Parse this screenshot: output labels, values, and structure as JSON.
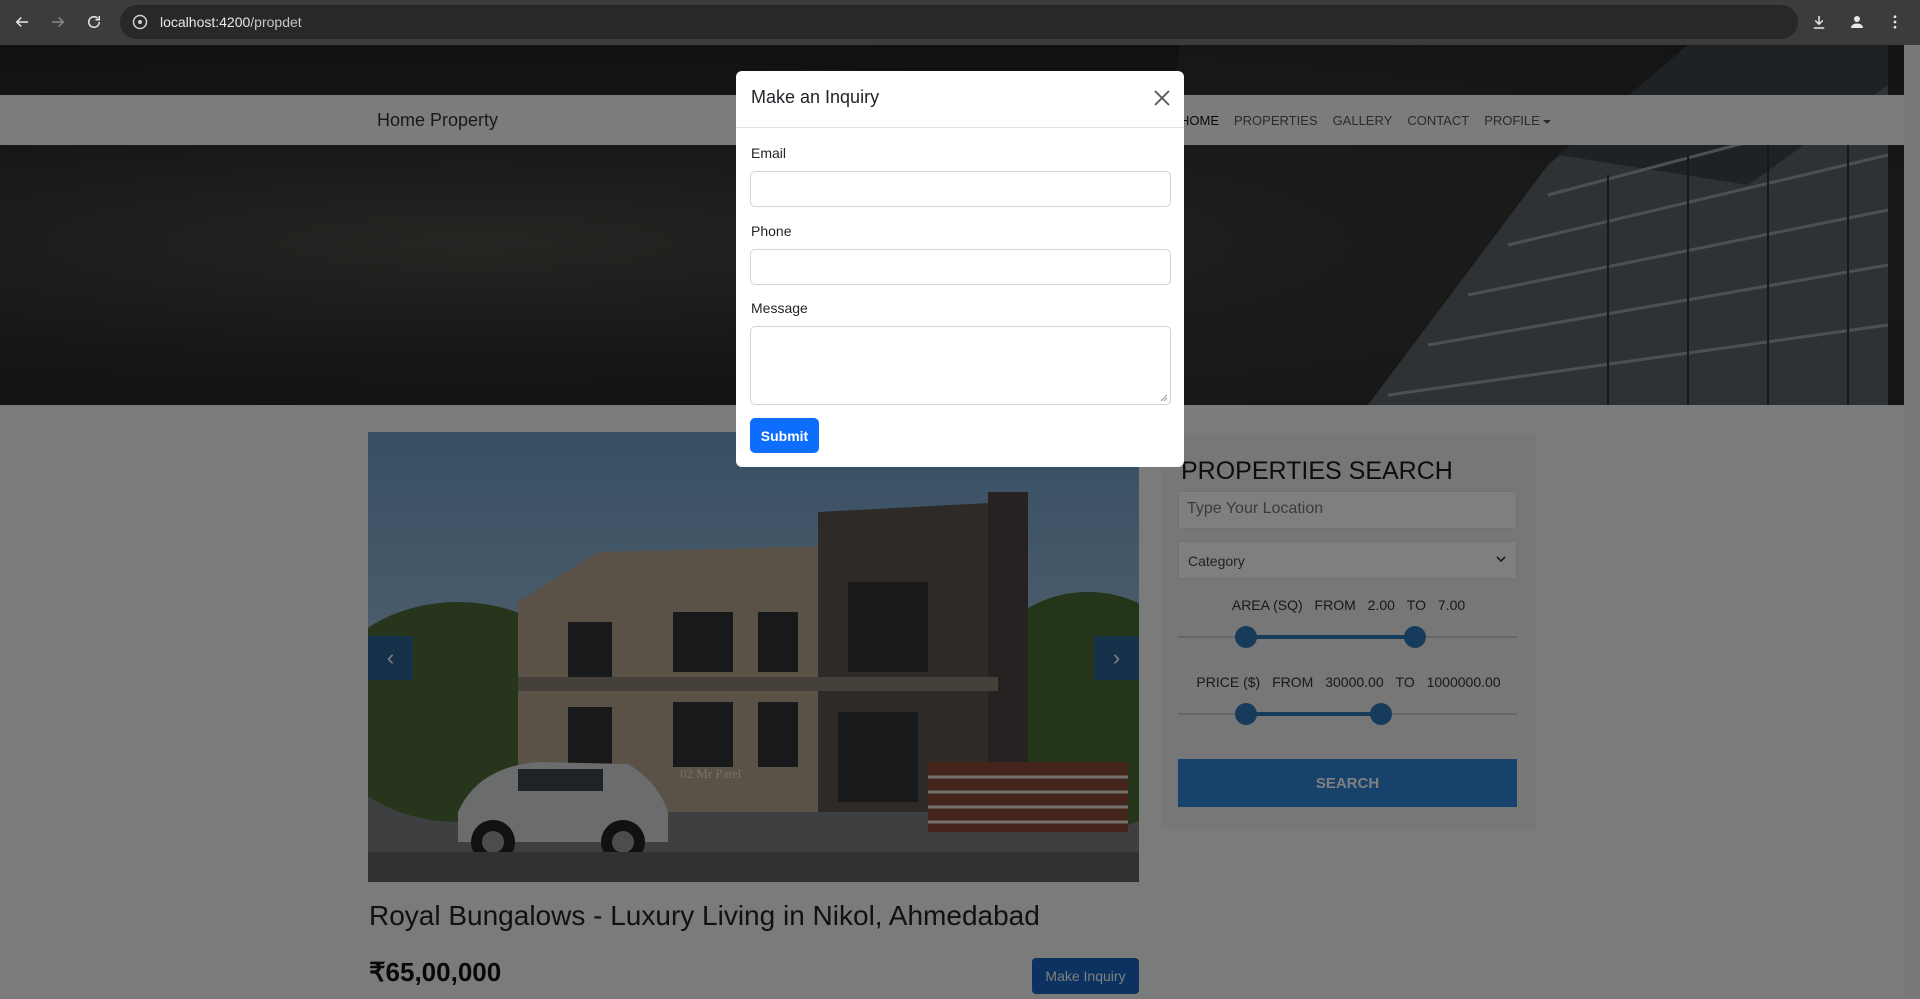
{
  "browser": {
    "url_host": "localhost:4200",
    "url_path": "/propdet"
  },
  "site": {
    "brand": "Home Property",
    "menu": [
      {
        "label": "HOME",
        "active": true
      },
      {
        "label": "PROPERTIES",
        "active": false
      },
      {
        "label": "GALLERY",
        "active": false
      },
      {
        "label": "CONTACT",
        "active": false
      },
      {
        "label": "PROFILE",
        "active": false
      }
    ]
  },
  "property": {
    "title": "Royal Bungalows - Luxury Living in Nikol, Ahmedabad",
    "price": "₹65,00,000",
    "inquiry_button": "Make Inquiry",
    "carousel_prev": "‹",
    "carousel_next": "›",
    "image_sign": "02 Mr Patel"
  },
  "search": {
    "title": "PROPERTIES SEARCH",
    "location_placeholder": "Type Your Location",
    "category_value": "Category",
    "area": {
      "label": "AREA (SQ)",
      "from_word": "FROM",
      "from": "2.00",
      "to_word": "TO",
      "to": "7.00",
      "from_fraction": 0.2,
      "to_fraction": 0.7
    },
    "price": {
      "label": "PRICE ($)",
      "from_word": "FROM",
      "from": "30000.00",
      "to_word": "TO",
      "to": "1000000.00",
      "from_fraction": 0.2,
      "to_fraction": 0.6
    },
    "button": "SEARCH"
  },
  "modal": {
    "title": "Make an Inquiry",
    "email_label": "Email",
    "phone_label": "Phone",
    "message_label": "Message",
    "submit": "Submit"
  }
}
